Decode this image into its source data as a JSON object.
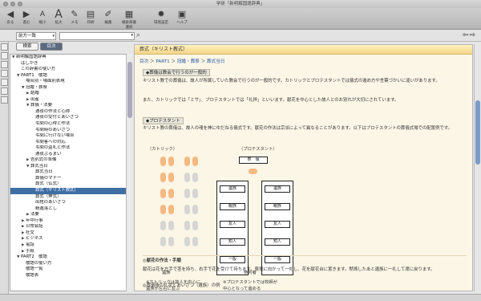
{
  "window": {
    "title": "学研「新明解国語辞典」"
  },
  "toolbar": [
    {
      "icon": "back-icon",
      "glyph": "◀",
      "label": "戻る"
    },
    {
      "icon": "forward-icon",
      "glyph": "▶",
      "label": "進む"
    },
    {
      "icon": "font-small-icon",
      "glyph": "A",
      "label": "縮小"
    },
    {
      "icon": "font-large-icon",
      "glyph": "A",
      "label": "拡大"
    },
    {
      "icon": "pen-icon",
      "glyph": "✎",
      "label": "メモ"
    },
    {
      "icon": "mark-icon",
      "glyph": "▤",
      "label": "印刷"
    },
    {
      "icon": "note-icon",
      "glyph": "✐",
      "label": "編集"
    },
    {
      "icon": "library-icon",
      "glyph": "▦",
      "label": "検索辞書選択"
    },
    {
      "icon": "gear-icon",
      "glyph": "✹",
      "label": "環境設定"
    },
    {
      "icon": "help-icon",
      "glyph": "▣",
      "label": "ヘルプ"
    }
  ],
  "search": {
    "mode": "前方一致",
    "value": ""
  },
  "tabs": {
    "list": "検索",
    "contents": "目次"
  },
  "tree": [
    {
      "indent": 0,
      "tri": "▼",
      "text": "新明解国語辞典",
      "sel": false
    },
    {
      "indent": 1,
      "tri": "",
      "text": "はしがき",
      "sel": false
    },
    {
      "indent": 1,
      "tri": "",
      "text": "この辞書の使い方",
      "sel": false
    },
    {
      "indent": 1,
      "tri": "▼",
      "text": "PART1　敬語",
      "sel": false
    },
    {
      "indent": 2,
      "tri": "",
      "text": "場合別・場面別表現",
      "sel": false
    },
    {
      "indent": 2,
      "tri": "▼",
      "text": "冠婚・葬祭",
      "sel": false
    },
    {
      "indent": 3,
      "tri": "▶",
      "text": "結婚",
      "sel": false
    },
    {
      "indent": 3,
      "tri": "▶",
      "text": "出産",
      "sel": false
    },
    {
      "indent": 3,
      "tri": "▼",
      "text": "葬儀・法要",
      "sel": false
    },
    {
      "indent": 4,
      "tri": "",
      "text": "通夜の作法と心得",
      "sel": false
    },
    {
      "indent": 4,
      "tri": "",
      "text": "通夜の受付とあいさつ",
      "sel": false
    },
    {
      "indent": 4,
      "tri": "",
      "text": "弔問の心得と作法",
      "sel": false
    },
    {
      "indent": 4,
      "tri": "",
      "text": "弔問時のあいさつ",
      "sel": false
    },
    {
      "indent": 4,
      "tri": "",
      "text": "弔問に行けない場合",
      "sel": false
    },
    {
      "indent": 4,
      "tri": "",
      "text": "弔問客への対応",
      "sel": false
    },
    {
      "indent": 4,
      "tri": "",
      "text": "弔問の返礼と作法",
      "sel": false
    },
    {
      "indent": 4,
      "tri": "",
      "text": "通夜ぶるまい",
      "sel": false
    },
    {
      "indent": 3,
      "tri": "▶",
      "text": "告別式の準備",
      "sel": false
    },
    {
      "indent": 3,
      "tri": "▼",
      "text": "葬式当日",
      "sel": false
    },
    {
      "indent": 4,
      "tri": "",
      "text": "葬式当日",
      "sel": false
    },
    {
      "indent": 4,
      "tri": "",
      "text": "葬儀のマナー",
      "sel": false
    },
    {
      "indent": 4,
      "tri": "",
      "text": "葬式（仏式）",
      "sel": false
    },
    {
      "indent": 4,
      "tri": "",
      "text": "葬式（キリスト教式）",
      "sel": true
    },
    {
      "indent": 4,
      "tri": "",
      "text": "葬式（神式）",
      "sel": false
    },
    {
      "indent": 4,
      "tri": "",
      "text": "出棺のあいさつ",
      "sel": false
    },
    {
      "indent": 4,
      "tri": "",
      "text": "精進落とし",
      "sel": false
    },
    {
      "indent": 3,
      "tri": "▶",
      "text": "法要",
      "sel": false
    },
    {
      "indent": 2,
      "tri": "▶",
      "text": "年中行事",
      "sel": false
    },
    {
      "indent": 2,
      "tri": "▶",
      "text": "日常会話",
      "sel": false
    },
    {
      "indent": 2,
      "tri": "▶",
      "text": "社交",
      "sel": false
    },
    {
      "indent": 2,
      "tri": "▶",
      "text": "ビジネス",
      "sel": false
    },
    {
      "indent": 2,
      "tri": "▶",
      "text": "電話",
      "sel": false
    },
    {
      "indent": 2,
      "tri": "▶",
      "text": "手紙",
      "sel": false
    },
    {
      "indent": 1,
      "tri": "▼",
      "text": "PART2　敬語",
      "sel": false
    },
    {
      "indent": 2,
      "tri": "",
      "text": "敬語の使い方",
      "sel": false
    },
    {
      "indent": 2,
      "tri": "",
      "text": "敬語一覧",
      "sel": false
    },
    {
      "indent": 2,
      "tri": "",
      "text": "敬語表",
      "sel": false
    }
  ],
  "content": {
    "header": "葬式（キリスト教式）",
    "breadcrumb": {
      "a": "目次",
      "b": "PART1",
      "c": "冠婚・葬祭",
      "d": "葬式当日"
    },
    "sec1": "◆葬儀は教会で行うのが一般的",
    "p1a": "キリスト教での葬儀は、故人が所属していた教会で行うのが一般的です。カトリックとプロテスタントでは儀式の進め方や言葉づかいに違いがあります。",
    "p1b": "また、カトリックでは「ミサ」、プロテスタントでは「礼拝」といいます。献花を中心とした故人とのお別れが大切にされています。",
    "sec2": "◆プロテスタント",
    "p2": "キリスト教の葬儀は、故人の魂を神にゆだねる儀式です。献花の作法は宗派によって異なることがあります。以下はプロテスタントの葬儀式場での配置例です。",
    "diagram": {
      "left_title": "（カトリック）",
      "mid_title": "（プロテスタント）",
      "altar": "祭　壇",
      "coffin": "棺",
      "labels": [
        "遺族",
        "親族",
        "友人",
        "知人",
        "一般"
      ],
      "caption_left1": "※カトリックは故人を中心に",
      "caption_left2": "遺族が左右に並ぶ",
      "caption_mid1": "※プロテスタントでは牧師が",
      "caption_mid2": "中心となって進める",
      "foot_left": "遺族",
      "foot_mid": "参列者"
    },
    "sec3": "◎献花の作法・手順",
    "p3": "献花は花を左手で茎を持ち、右手で花を受けて持ちます。祭壇に向かって一礼し、花を献花台に置きます。黙祷したあと遺族に一礼して席に戻ります。",
    "p4": "◎葬儀後の礼状とあいさつ（遺族）の例"
  },
  "statusbar": {
    "left": "",
    "right": ""
  }
}
